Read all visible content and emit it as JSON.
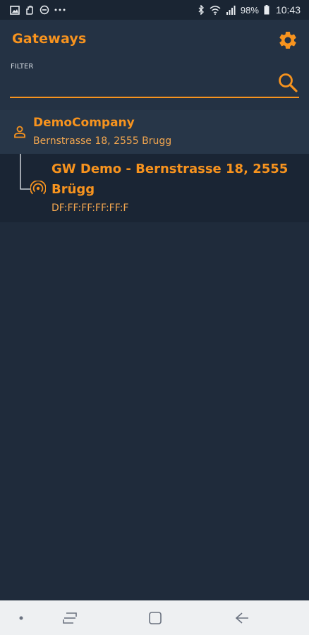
{
  "status_bar": {
    "battery_percent": "98%",
    "time": "10:43",
    "left_icons": [
      "image-icon",
      "hand-icon",
      "do-not-disturb-icon",
      "more-dots-icon"
    ],
    "right_icons": [
      "bluetooth-icon",
      "wifi-icon",
      "signal-icon",
      "battery-icon"
    ]
  },
  "header": {
    "title": "Gateways",
    "filter_label": "FILTER",
    "filter_value": "",
    "settings_icon": "gear-icon",
    "search_icon": "search-icon"
  },
  "company": {
    "name": "DemoCompany",
    "address": "Bernstrasse 18, 2555 Brugg",
    "icon": "person-icon"
  },
  "gateway": {
    "name": "GW Demo - Bernstrasse 18, 2555 Brügg",
    "mac": "DF:FF:FF:FF:FF:F",
    "icon": "gateway-signal-icon"
  },
  "nav_bar": {
    "buttons": [
      "dot-icon",
      "recents-icon",
      "home-icon",
      "back-icon"
    ]
  },
  "colors": {
    "accent": "#f7931e",
    "background": "#1f2b3b",
    "header": "#243244",
    "nav_bar": "#eef0f2"
  }
}
